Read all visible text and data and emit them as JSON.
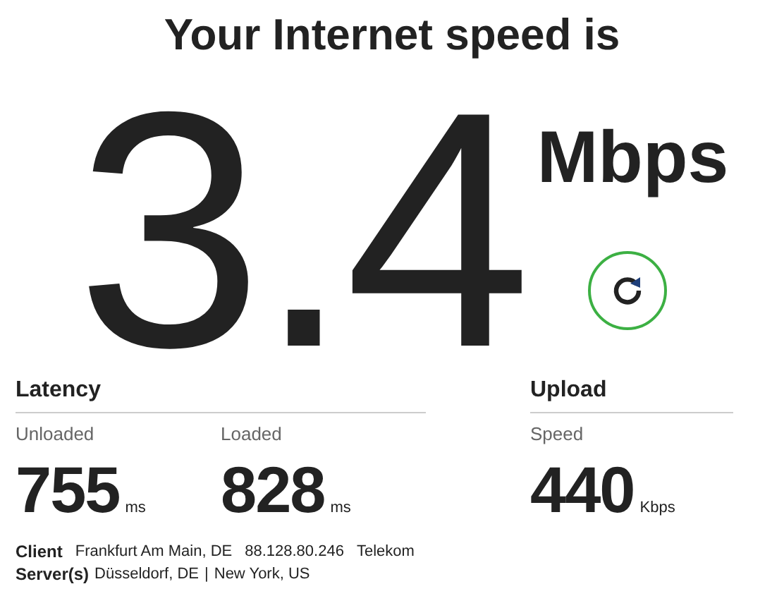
{
  "title": "Your Internet speed is",
  "speed": {
    "value": "3.4",
    "unit": "Mbps"
  },
  "sections": [
    {
      "heading": "Latency",
      "metrics": [
        {
          "label": "Unloaded",
          "value": "755",
          "unit": "ms"
        },
        {
          "label": "Loaded",
          "value": "828",
          "unit": "ms"
        }
      ]
    },
    {
      "heading": "Upload",
      "metrics": [
        {
          "label": "Speed",
          "value": "440",
          "unit": "Kbps"
        }
      ]
    }
  ],
  "client": {
    "label": "Client",
    "items": [
      "Frankfurt Am Main, DE",
      "88.128.80.246",
      "Telekom"
    ]
  },
  "servers": {
    "label": "Server(s)",
    "items": [
      "Düsseldorf, DE",
      "New York, US"
    ],
    "separator": "|"
  }
}
